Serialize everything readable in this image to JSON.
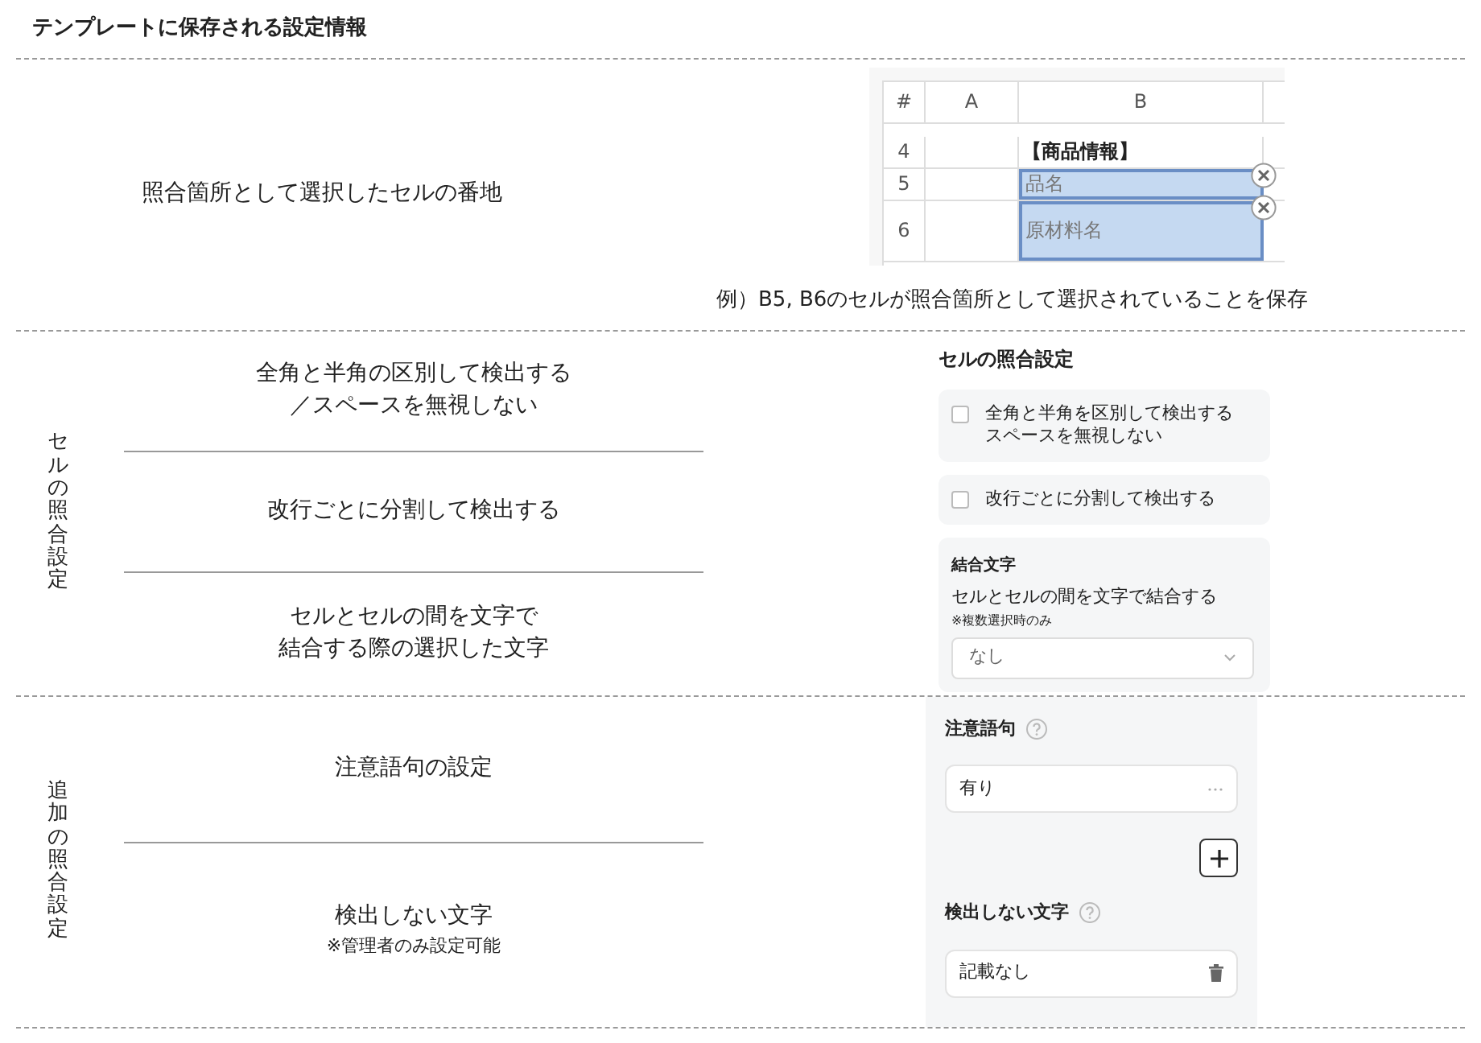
{
  "title": "テンプレートに保存される設定情報",
  "address": {
    "item": "照合箇所として選択したセルの番地",
    "sheet": {
      "columns": [
        "#",
        "A",
        "B"
      ],
      "rows": [
        {
          "number": "4",
          "a": "",
          "b": "【商品情報】",
          "selected": false
        },
        {
          "number": "5",
          "a": "",
          "b": "品名",
          "selected": true
        },
        {
          "number": "6",
          "a": "",
          "b": "原材料名",
          "selected": true
        }
      ]
    },
    "caption": "例）B5, B6のセルが照合箇所として選択されていることを保存"
  },
  "cell_settings": {
    "label": "セルの照合設定",
    "items": [
      {
        "lines": [
          "全角と半角の区別して検出する",
          "／スペースを無視しない"
        ]
      },
      {
        "lines": [
          "改行ごとに分割して検出する"
        ]
      },
      {
        "lines": [
          "セルとセルの間を文字で",
          "結合する際の選択した文字"
        ]
      }
    ],
    "panel": {
      "title": "セルの照合設定",
      "options": [
        {
          "lines": [
            "全角と半角を区別して検出する",
            "スペースを無視しない"
          ],
          "checked": false
        },
        {
          "lines": [
            "改行ごとに分割して検出する"
          ],
          "checked": false
        }
      ],
      "join": {
        "title": "結合文字",
        "description": "セルとセルの間を文字で結合する",
        "note": "※複数選択時のみ",
        "value": "なし"
      }
    }
  },
  "extra_settings": {
    "label": "追加の照合設定",
    "items": [
      {
        "lines": [
          "注意語句の設定"
        ]
      },
      {
        "lines": [
          "検出しない文字"
        ],
        "note": "※管理者のみ設定可能"
      }
    ],
    "panel": {
      "caution": {
        "title": "注意語句",
        "value": "有り"
      },
      "exclude": {
        "title": "検出しない文字",
        "value": "記載なし"
      }
    }
  }
}
